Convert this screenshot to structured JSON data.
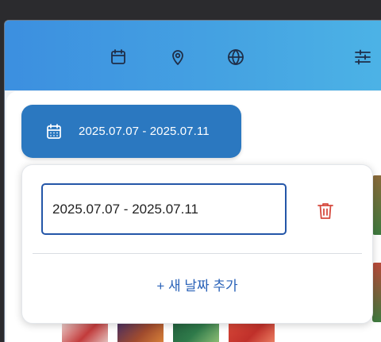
{
  "toolbar": {
    "icons": [
      "calendar-icon",
      "location-pin-icon",
      "globe-icon",
      "filter-sliders-icon"
    ]
  },
  "date_chip": {
    "icon": "calendar-icon",
    "range": "2025.07.07 - 2025.07.11"
  },
  "date_popup": {
    "field_value": "2025.07.07 - 2025.07.11",
    "delete_icon": "trash-icon",
    "add_date_label": "+ 새 날짜 추가"
  },
  "colors": {
    "header_gradient_start": "#3c8fe0",
    "header_gradient_end": "#4cb3e6",
    "chip_background": "#2b78c0",
    "field_border": "#2456a8",
    "delete_icon": "#d64a3f",
    "add_link": "#2a62b8"
  }
}
